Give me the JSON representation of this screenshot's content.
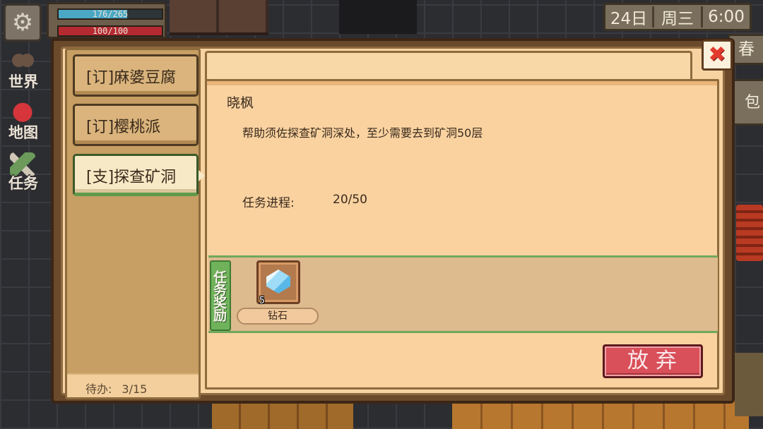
{
  "hud": {
    "hp_text": "176/265",
    "hp_fraction": 0.664,
    "energy_text": "100/100",
    "energy_fraction": 1.0,
    "day": "24日",
    "weekday": "周三",
    "time": "6:00",
    "season": "春",
    "bag_partial": "包"
  },
  "side_menu": [
    {
      "label": "世界",
      "icon": "world-icon"
    },
    {
      "label": "地图",
      "icon": "map-pin-icon"
    },
    {
      "label": "任务",
      "icon": "quest-scroll-icon"
    }
  ],
  "quests": {
    "items": [
      {
        "label": "[订]麻婆豆腐",
        "active": false
      },
      {
        "label": "[订]樱桃派",
        "active": false
      },
      {
        "label": "[支]探查矿洞",
        "active": true
      }
    ],
    "todo_label": "待办:",
    "todo_value": "3/15"
  },
  "detail": {
    "npc_name": "晓枫",
    "description": "帮助须佐探查矿洞深处，至少需要去到矿洞50层",
    "progress_label": "任务进程:",
    "progress_value": "20/50",
    "reward_label": "任务奖励",
    "rewards": [
      {
        "name": "钻石",
        "count": "5",
        "icon": "diamond-icon"
      }
    ],
    "abandon_label": "放弃"
  },
  "colors": {
    "panel": "#f9d2a0",
    "accent_green": "#6fb25a",
    "abandon_red": "#d9505a",
    "close_red": "#e23a2e"
  }
}
